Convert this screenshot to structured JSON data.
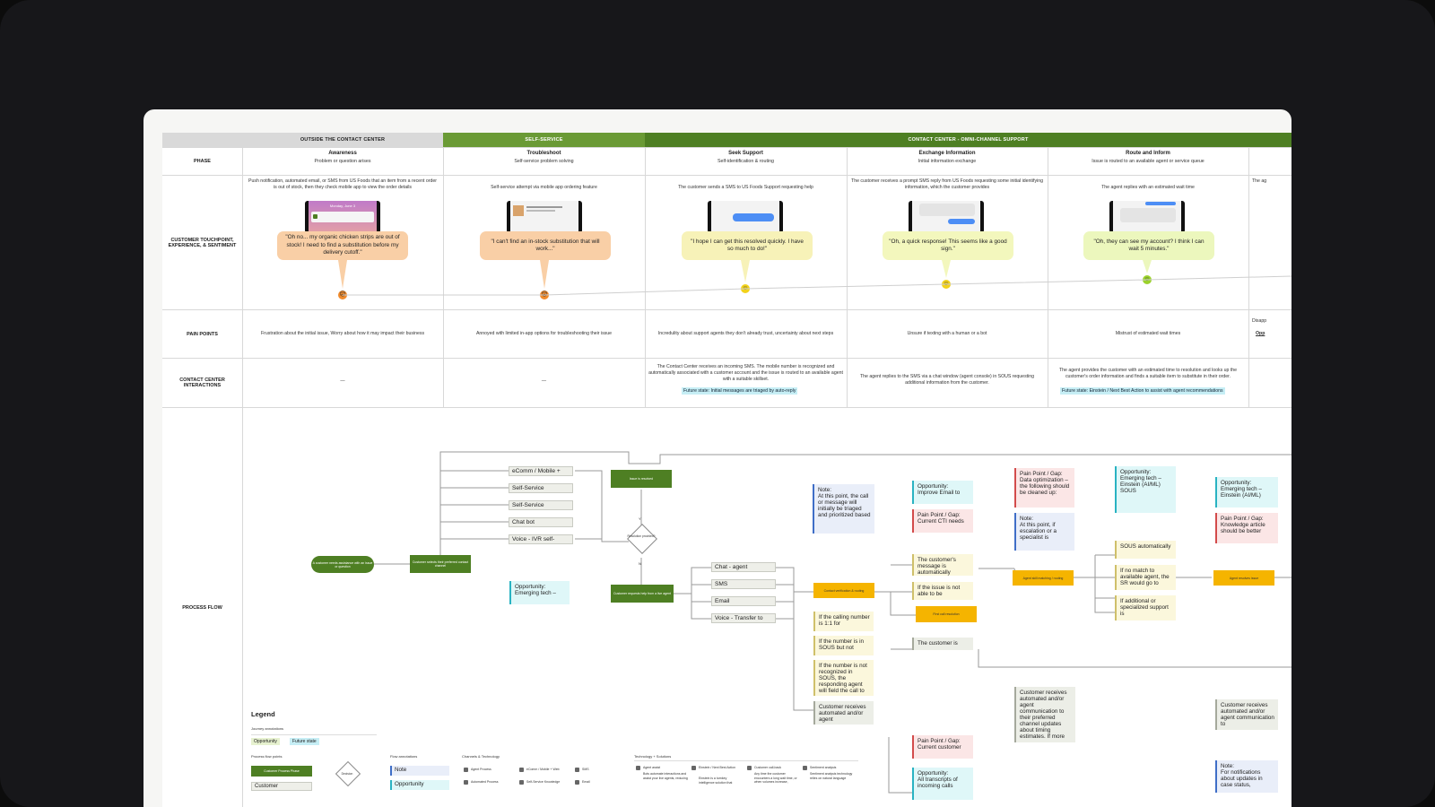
{
  "sections": [
    {
      "label": "OUTSIDE THE CONTACT CENTER",
      "color": "#d9d9d9",
      "text": "#222222"
    },
    {
      "label": "SELF-SERVICE",
      "color": "#6a9a35",
      "text": "#ffffff"
    },
    {
      "label": "CONTACT CENTER - OMNI-CHANNEL SUPPORT",
      "color": "#4e7f23",
      "text": "#ffffff"
    }
  ],
  "row_labels": {
    "phase": "PHASE",
    "touchpoint": "CUSTOMER TOUCHPOINT, EXPERIENCE, & SENTIMENT",
    "pain": "PAIN POINTS",
    "interactions": "CONTACT CENTER INTERACTIONS",
    "process": "PROCESS FLOW"
  },
  "phases": [
    {
      "title": "Awareness",
      "subtitle": "Problem or question arises",
      "description": "Push notification, automated email, or SMS from US Foods that an item from a recent order is out of stock, then they check mobile app to view the order details",
      "quote": "\"Oh no... my organic chicken strips are out of stock! I need to find a substitution before my delivery cutoff.\"",
      "sentiment": "negative",
      "bubble_color": "#f9cfa6",
      "pain": "Frustration about the initial issue, Worry about how it may impact their business",
      "interaction": "—",
      "future": "",
      "screen_text": "Monday, June 3"
    },
    {
      "title": "Troubleshoot",
      "subtitle": "Self-service problem solving",
      "description": "Self-service attempt via mobile app ordering feature",
      "quote": "\"I can't find an in-stock substitution that will work...\"",
      "sentiment": "negative",
      "bubble_color": "#f9cfa6",
      "pain": "Annoyed with limited in-app options for troubleshooting their issue",
      "interaction": "—",
      "future": "",
      "screen_text": ""
    },
    {
      "title": "Seek Support",
      "subtitle": "Self-identification & routing",
      "description": "The customer sends a SMS to US Foods Support requesting help",
      "quote": "\"I hope I can get this resolved quickly. I have so much to do!\"",
      "sentiment": "neutral",
      "bubble_color": "#f7f2b8",
      "pain": "Incredulity about support agents they don't already trust, uncertainty about next steps",
      "interaction": "The Contact Center receives an incoming SMS. The mobile number is recognized and automatically associated with a customer account and the issue is routed to an available agent with a suitable skillset.",
      "future": "Future state: Initial messages are triaged by auto-reply",
      "screen_text": ""
    },
    {
      "title": "Exchange Information",
      "subtitle": "Initial information exchange",
      "description": "The customer receives a prompt SMS reply from US Foods requesting some initial identifying information, which the customer provides",
      "quote": "\"Oh, a quick response! This seems like a good sign.\"",
      "sentiment": "neutral",
      "bubble_color": "#f3f7bd",
      "pain": "Unsure if texting with a human or a bot",
      "interaction": "The agent replies to the SMS via a chat window (agent console) in SOUS requesting additional information from the customer.",
      "future": "",
      "screen_text": ""
    },
    {
      "title": "Route and Inform",
      "subtitle": "Issue is routed to an available agent or service queue",
      "description": "The agent replies with an estimated wait time",
      "quote": "\"Oh, they can see my account? I think I can wait 5 minutes.\"",
      "sentiment": "neutral",
      "bubble_color": "#ecf7bd",
      "pain": "Mistrust of estimated wait times",
      "interaction": "The agent provides the customer with an estimated time to resolution and looks up the customer's order information and finds a suitable item to substitute in their order.",
      "future": "Future state: Einstein / Next Best Action to assist with agent recommendations",
      "screen_text": ""
    },
    {
      "title": "",
      "subtitle": "",
      "description": "The ag",
      "quote": "",
      "sentiment": "",
      "bubble_color": "",
      "pain": "Disapp",
      "interaction": "",
      "future": "",
      "screen_text": "",
      "extra": "Opp"
    }
  ],
  "process": {
    "start": "A customer needs assistance with an issue or question",
    "choose_channel": "Customer selects their preferred contact channel",
    "channels": [
      "eComm / Mobile +",
      "Self-Service",
      "Self-Service",
      "Chat bot",
      "Voice - IVR self-"
    ],
    "issue_resolved": "Issue is resolved",
    "decision": "Resolution provided?",
    "yes": "Y",
    "no": "N",
    "opportunity_1": [
      "Opportunity:",
      "Emerging tech –"
    ],
    "request_agent": "Customer requests help from a live agent",
    "agent_channels": [
      "Chat - agent",
      "SMS",
      "Email",
      "Voice - Transfer to"
    ],
    "verify": "Contact verification & routing",
    "note_1": [
      "Note:",
      "At this point, the call or message will initially be triaged and prioritized based"
    ],
    "conditions": [
      "If the calling number is 1:1 for",
      "If the number is in SOUS but not",
      "If the number is not recognized in SOUS, the responding agent will field the call to",
      "Customer receives automated and/or agent"
    ],
    "opportunity_2": [
      "Opportunity:",
      "Improve Email to"
    ],
    "pain_1": [
      "Pain Point / Gap:",
      "Current CTI needs"
    ],
    "msg_auto": "The customer's message is automatically",
    "if_issue": "If the issue is not able to be",
    "first_call": "First call resolution",
    "cust_is": "The customer is",
    "pain_2": [
      "Pain Point / Gap:",
      "Current customer"
    ],
    "opportunity_3": [
      "Opportunity:",
      "All transcripts of incoming calls"
    ],
    "pain_3": [
      "Pain Point / Gap:",
      "Data optimization – the following should be cleaned up:"
    ],
    "note_2": [
      "Note:",
      "At this point, if escalation or a specialist is"
    ],
    "agent_skill": "Agent skill matching / routing",
    "cust_receives_2": "Customer receives automated and/or agent communication to their preferred channel updates about timing estimates. If more",
    "opportunity_4": [
      "Opportunity:",
      "Emerging tech – Einstein (AI/ML)",
      "SOUS"
    ],
    "sous_auto": "SOUS automatically",
    "if_no_match": "If no match to available agent, the SR would go to",
    "if_additional": "If additional or specialized support is",
    "opportunity_5": [
      "Opportunity:",
      "Emerging tech – Einstein (AI/ML)"
    ],
    "pain_4": [
      "Pain Point / Gap:",
      "Knowledge article should be better"
    ],
    "agent_resolve": "Agent resolves issue",
    "cust_receives_3": "Customer receives automated and/or agent communication to",
    "note_3": [
      "Note:",
      "For notifications about updates in case status,"
    ]
  },
  "legend": {
    "title": "Legend",
    "journey": "Journey annotations",
    "opportunity": "Opportunity",
    "future_state": "Future state",
    "process_points": "Process flow points",
    "customer_process": "Customer Process Phase",
    "decision": "Decision",
    "customer": "Customer",
    "flow_annotations": "Flow annotations",
    "note": "Note",
    "opportunity_chip": "Opportunity",
    "channels_title": "Channels & Technology",
    "channels": [
      "Agent Process",
      "Automated Process",
      "eComm / Mobile + Web",
      "Self-Service Knowledge",
      "SMS",
      "Email"
    ],
    "tech_title": "Technology + Solutions",
    "tech": [
      {
        "name": "Agent assist",
        "desc": "Bots automate interactions and assist your live agents, reducing"
      },
      {
        "name": "Einstein / Next Best Action",
        "desc": "Einstein is a turnkey intelligence solution that"
      },
      {
        "name": "Customer call-back",
        "desc": "Any time the customer encounters a long wait time, or when volumes increase,"
      },
      {
        "name": "Sentiment analysis",
        "desc": "Sentiment analysis technology relies on natural language"
      }
    ]
  },
  "colors": {
    "dark_green": "#4e7f23",
    "self_service_green": "#6a9a35",
    "orange_node": "#f5b400",
    "future_state": "#c6eef5",
    "negative_face": "#f08a2b",
    "neutral_face": "#f2d21b",
    "positive_face": "#9bd22b"
  }
}
